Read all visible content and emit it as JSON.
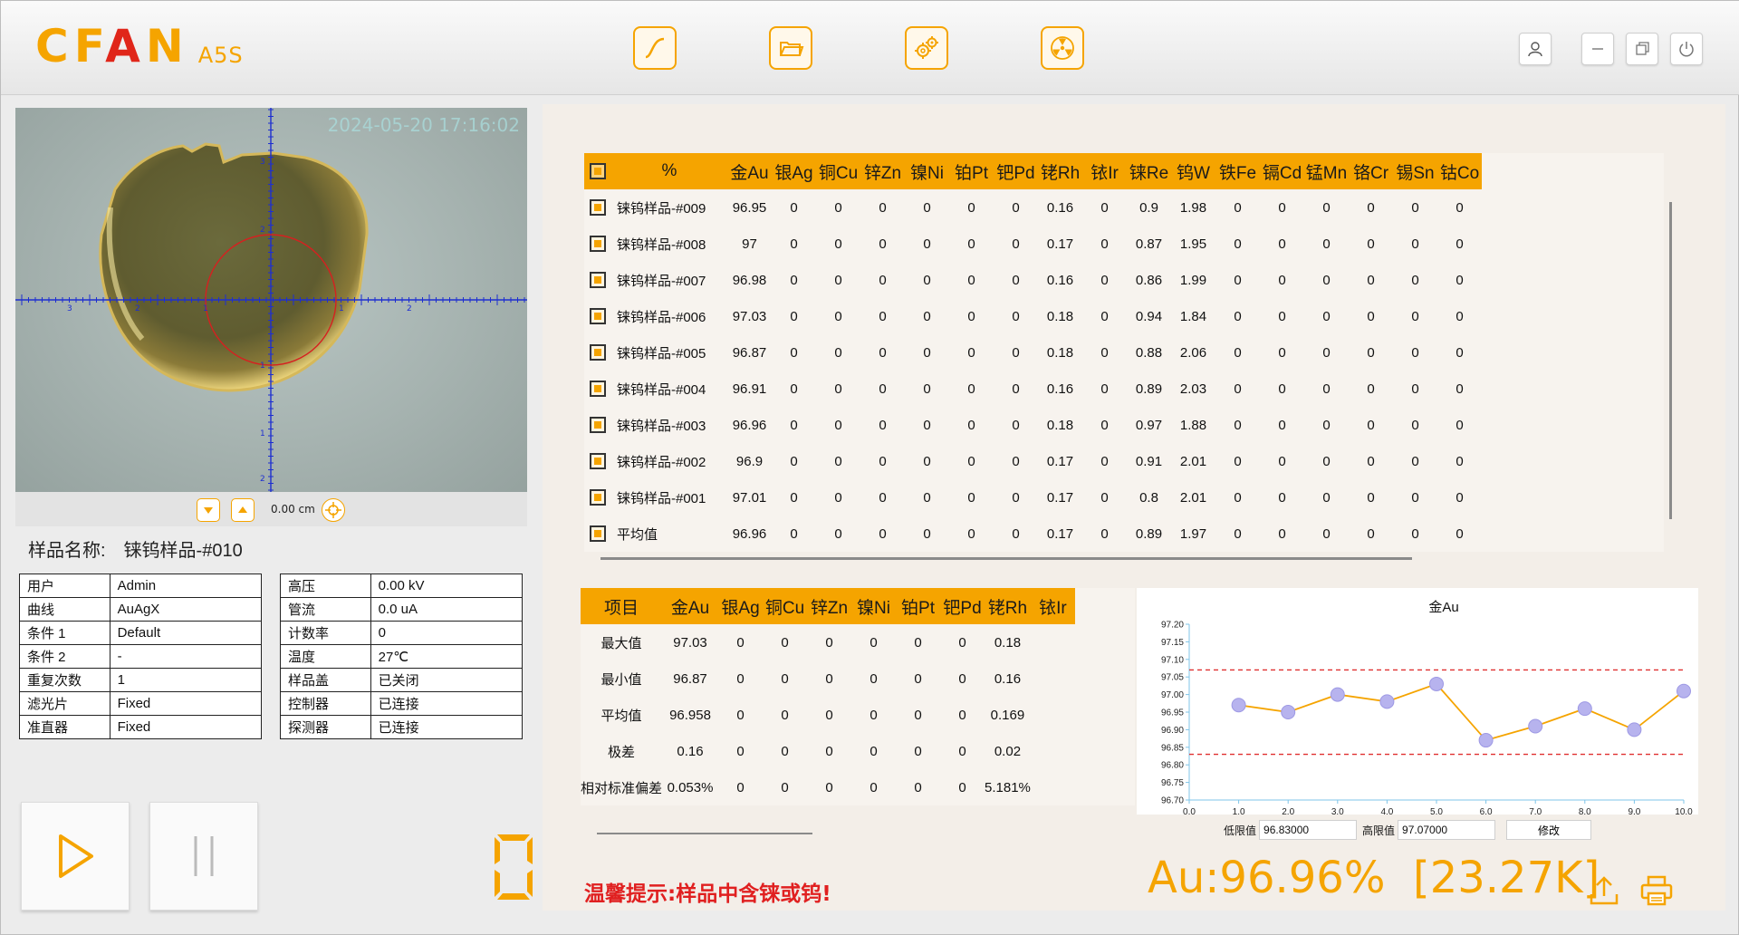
{
  "header": {
    "logo_main_1": "CF",
    "logo_main_2": "A",
    "logo_main_3": "N",
    "logo_sub": "A5S",
    "tools": [
      "curve-icon",
      "folder-icon",
      "settings-icon",
      "radiation-icon"
    ],
    "window": [
      "user-icon",
      "minimize-icon",
      "restore-icon",
      "power-icon"
    ]
  },
  "camera": {
    "timestamp": "2024-05-20 17:16:02",
    "scale_text": "0.00 cm",
    "axis_labels": [
      "3",
      "2",
      "1",
      "1",
      "2",
      "3",
      "2",
      "1",
      "1",
      "2"
    ]
  },
  "sample": {
    "label": "样品名称:",
    "value": "铼钨样品-#010"
  },
  "info_left": [
    {
      "k": "用户",
      "v": "Admin"
    },
    {
      "k": "曲线",
      "v": "AuAgX"
    },
    {
      "k": "条件 1",
      "v": "Default"
    },
    {
      "k": "条件 2",
      "v": "-"
    },
    {
      "k": "重复次数",
      "v": "1"
    },
    {
      "k": "滤光片",
      "v": "Fixed"
    },
    {
      "k": "准直器",
      "v": "Fixed"
    }
  ],
  "info_right": [
    {
      "k": "高压",
      "v": "0.00 kV"
    },
    {
      "k": "管流",
      "v": "0.0 uA"
    },
    {
      "k": "计数率",
      "v": "0"
    },
    {
      "k": "温度",
      "v": "27℃"
    },
    {
      "k": "样品盖",
      "v": "已关闭"
    },
    {
      "k": "控制器",
      "v": "已连接"
    },
    {
      "k": "探测器",
      "v": "已连接"
    }
  ],
  "digit_display": "0",
  "main_table": {
    "pct_header": "%",
    "columns": [
      "金Au",
      "银Ag",
      "铜Cu",
      "锌Zn",
      "镍Ni",
      "铂Pt",
      "钯Pd",
      "铑Rh",
      "铱Ir",
      "铼Re",
      "钨W",
      "铁Fe",
      "镉Cd",
      "锰Mn",
      "铬Cr",
      "锡Sn",
      "钴Co"
    ],
    "rows": [
      {
        "name": "铼钨样品-#009",
        "values": [
          "96.95",
          "0",
          "0",
          "0",
          "0",
          "0",
          "0",
          "0.16",
          "0",
          "0.9",
          "1.98",
          "0",
          "0",
          "0",
          "0",
          "0",
          "0"
        ]
      },
      {
        "name": "铼钨样品-#008",
        "values": [
          "97",
          "0",
          "0",
          "0",
          "0",
          "0",
          "0",
          "0.17",
          "0",
          "0.87",
          "1.95",
          "0",
          "0",
          "0",
          "0",
          "0",
          "0"
        ]
      },
      {
        "name": "铼钨样品-#007",
        "values": [
          "96.98",
          "0",
          "0",
          "0",
          "0",
          "0",
          "0",
          "0.16",
          "0",
          "0.86",
          "1.99",
          "0",
          "0",
          "0",
          "0",
          "0",
          "0"
        ]
      },
      {
        "name": "铼钨样品-#006",
        "values": [
          "97.03",
          "0",
          "0",
          "0",
          "0",
          "0",
          "0",
          "0.18",
          "0",
          "0.94",
          "1.84",
          "0",
          "0",
          "0",
          "0",
          "0",
          "0"
        ]
      },
      {
        "name": "铼钨样品-#005",
        "values": [
          "96.87",
          "0",
          "0",
          "0",
          "0",
          "0",
          "0",
          "0.18",
          "0",
          "0.88",
          "2.06",
          "0",
          "0",
          "0",
          "0",
          "0",
          "0"
        ]
      },
      {
        "name": "铼钨样品-#004",
        "values": [
          "96.91",
          "0",
          "0",
          "0",
          "0",
          "0",
          "0",
          "0.16",
          "0",
          "0.89",
          "2.03",
          "0",
          "0",
          "0",
          "0",
          "0",
          "0"
        ]
      },
      {
        "name": "铼钨样品-#003",
        "values": [
          "96.96",
          "0",
          "0",
          "0",
          "0",
          "0",
          "0",
          "0.18",
          "0",
          "0.97",
          "1.88",
          "0",
          "0",
          "0",
          "0",
          "0",
          "0"
        ]
      },
      {
        "name": "铼钨样品-#002",
        "values": [
          "96.9",
          "0",
          "0",
          "0",
          "0",
          "0",
          "0",
          "0.17",
          "0",
          "0.91",
          "2.01",
          "0",
          "0",
          "0",
          "0",
          "0",
          "0"
        ]
      },
      {
        "name": "铼钨样品-#001",
        "values": [
          "97.01",
          "0",
          "0",
          "0",
          "0",
          "0",
          "0",
          "0.17",
          "0",
          "0.8",
          "2.01",
          "0",
          "0",
          "0",
          "0",
          "0",
          "0"
        ]
      },
      {
        "name": "平均值",
        "values": [
          "96.96",
          "0",
          "0",
          "0",
          "0",
          "0",
          "0",
          "0.17",
          "0",
          "0.89",
          "1.97",
          "0",
          "0",
          "0",
          "0",
          "0",
          "0"
        ]
      }
    ]
  },
  "stats_table": {
    "item_header": "项目",
    "columns": [
      "金Au",
      "银Ag",
      "铜Cu",
      "锌Zn",
      "镍Ni",
      "铂Pt",
      "钯Pd",
      "铑Rh",
      "铱Ir"
    ],
    "rows": [
      {
        "name": "最大值",
        "values": [
          "97.03",
          "0",
          "0",
          "0",
          "0",
          "0",
          "0",
          "0.18",
          ""
        ]
      },
      {
        "name": "最小值",
        "values": [
          "96.87",
          "0",
          "0",
          "0",
          "0",
          "0",
          "0",
          "0.16",
          ""
        ]
      },
      {
        "name": "平均值",
        "values": [
          "96.958",
          "0",
          "0",
          "0",
          "0",
          "0",
          "0",
          "0.169",
          ""
        ]
      },
      {
        "name": "极差",
        "values": [
          "0.16",
          "0",
          "0",
          "0",
          "0",
          "0",
          "0",
          "0.02",
          ""
        ]
      },
      {
        "name": "相对标准偏差",
        "values": [
          "0.053%",
          "0",
          "0",
          "0",
          "0",
          "0",
          "0",
          "5.181%",
          ""
        ]
      }
    ]
  },
  "chart_data": {
    "type": "line",
    "title": "金Au",
    "x": [
      1,
      2,
      3,
      4,
      5,
      6,
      7,
      8,
      9,
      10
    ],
    "series": [
      {
        "values": [
          96.97,
          96.95,
          97.0,
          96.98,
          97.03,
          96.87,
          96.91,
          96.96,
          96.9,
          97.01
        ]
      }
    ],
    "xlim": [
      0,
      10
    ],
    "ylim": [
      96.7,
      97.2
    ],
    "xticks": [
      "0.0",
      "1.0",
      "2.0",
      "3.0",
      "4.0",
      "5.0",
      "6.0",
      "7.0",
      "8.0",
      "9.0",
      "10.0"
    ],
    "yticks": [
      "96.70",
      "96.75",
      "96.80",
      "96.85",
      "96.90",
      "96.95",
      "97.00",
      "97.05",
      "97.10",
      "97.15",
      "97.20"
    ],
    "lower_limit": 96.83,
    "upper_limit": 97.07,
    "line_color": "#f5a400",
    "marker_color": "#b7b3ee",
    "limit_color": "#e03030",
    "grid": false
  },
  "limits": {
    "low_label": "低限值",
    "low_value": "96.83000",
    "high_label": "高限值",
    "high_value": "97.07000",
    "modify_label": "修改"
  },
  "tip": "温馨提示:样品中含铼或钨!",
  "result": "Au:96.96%  [23.27K]",
  "colors": {
    "accent": "#f5a400",
    "warning": "#e02020",
    "logo_red": "#e0261a"
  }
}
